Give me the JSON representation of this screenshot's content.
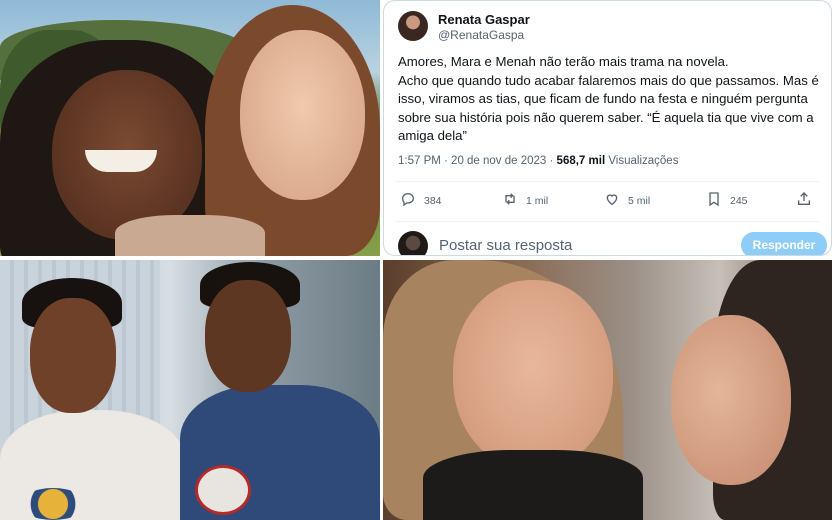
{
  "tweet": {
    "author_name": "Renata Gaspar",
    "author_handle": "@RenataGaspa",
    "text_lines": [
      "Amores, Mara e Menah não terão mais trama na novela.",
      "Acho que quando tudo acabar falaremos mais do que passamos. Mas é isso, viramos as tias, que ficam de fundo na festa e ninguém pergunta sobre sua história pois não querem saber. “É aquela tia que vive com a amiga dela”"
    ],
    "timestamp": "1:57 PM · 20 de nov de 2023 · ",
    "views_count": "568,7 mil",
    "views_label": " Visualizações",
    "actions": {
      "reply_count": "384",
      "retweet_count": "1 mil",
      "like_count": "5 mil",
      "bookmark_count": "245"
    },
    "reply_placeholder": "Postar sua resposta",
    "reply_button": "Responder",
    "accent_color": "#1d9bf0"
  },
  "icons": [
    "reply-icon",
    "retweet-icon",
    "like-icon",
    "bookmark-icon",
    "share-icon"
  ]
}
